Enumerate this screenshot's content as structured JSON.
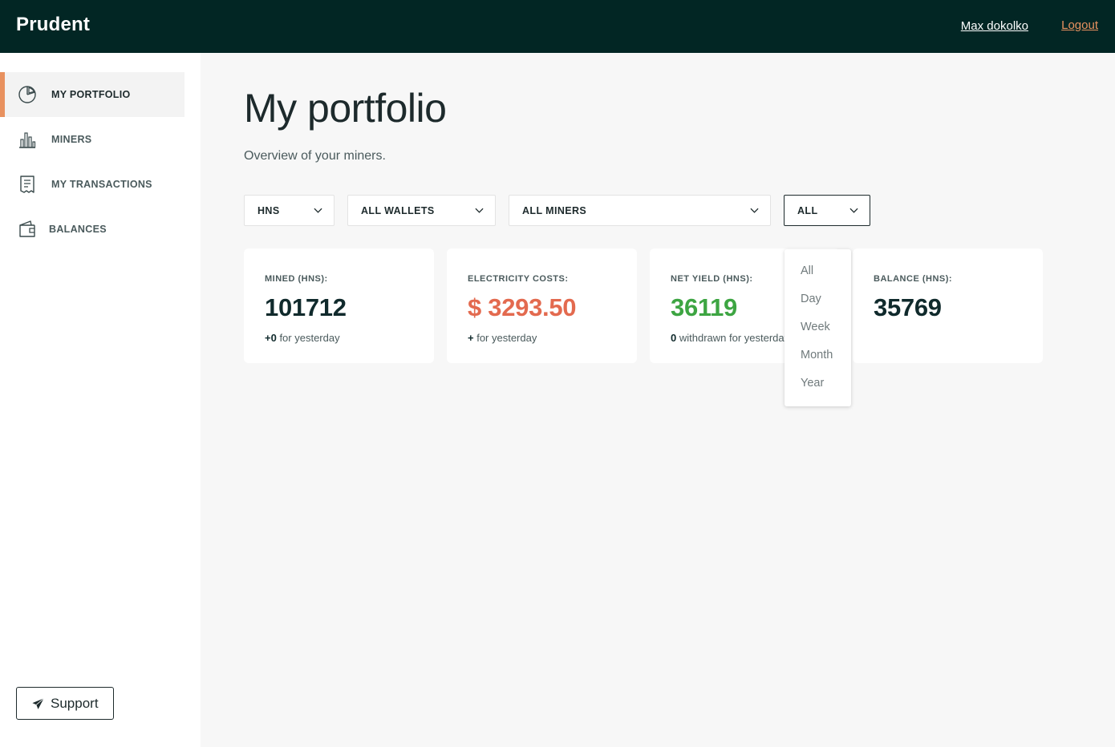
{
  "header": {
    "brand": "Prudent",
    "user_name": "Max dokolko",
    "logout_label": "Logout"
  },
  "sidebar": {
    "items": [
      {
        "label": "MY PORTFOLIO",
        "icon": "pie-chart-icon",
        "active": true
      },
      {
        "label": "MINERS",
        "icon": "bar-chart-icon",
        "active": false
      },
      {
        "label": "MY TRANSACTIONS",
        "icon": "receipt-icon",
        "active": false
      },
      {
        "label": "BALANCES",
        "icon": "wallet-icon",
        "active": false
      }
    ],
    "support_label": "Support"
  },
  "main": {
    "title": "My portfolio",
    "subtitle": "Overview of your miners.",
    "filters": [
      {
        "value": "HNS"
      },
      {
        "value": "ALL WALLETS"
      },
      {
        "value": "ALL MINERS"
      },
      {
        "value": "ALL"
      }
    ],
    "period_options": [
      "All",
      "Day",
      "Week",
      "Month",
      "Year"
    ],
    "cards": [
      {
        "label": "MINED (HNS):",
        "value": "101712",
        "sub_bold": "+0",
        "sub_text": " for yesterday"
      },
      {
        "label": "ELECTRICITY COSTS:",
        "value": "$ 3293.50",
        "sub_bold": "+",
        "sub_text": " for yesterday"
      },
      {
        "label": "NET YIELD (HNS):",
        "value": "36119",
        "sub_bold": "0",
        "sub_text": " withdrawn for yesterday"
      },
      {
        "label": "BALANCE (HNS):",
        "value": "35769"
      }
    ]
  },
  "colors": {
    "topbar": "#022624",
    "accent": "#e8915f",
    "cost_red": "#e36a4f",
    "yield_green": "#3da542"
  }
}
